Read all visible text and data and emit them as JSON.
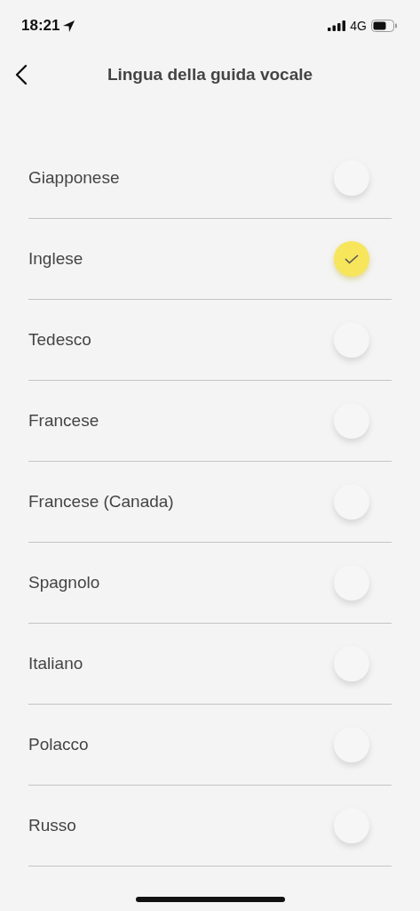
{
  "status_bar": {
    "time": "18:21",
    "network": "4G"
  },
  "header": {
    "title": "Lingua della guida vocale"
  },
  "languages": [
    {
      "label": "Giapponese",
      "selected": false
    },
    {
      "label": "Inglese",
      "selected": true
    },
    {
      "label": "Tedesco",
      "selected": false
    },
    {
      "label": "Francese",
      "selected": false
    },
    {
      "label": "Francese (Canada)",
      "selected": false
    },
    {
      "label": "Spagnolo",
      "selected": false
    },
    {
      "label": "Italiano",
      "selected": false
    },
    {
      "label": "Polacco",
      "selected": false
    },
    {
      "label": "Russo",
      "selected": false
    }
  ]
}
